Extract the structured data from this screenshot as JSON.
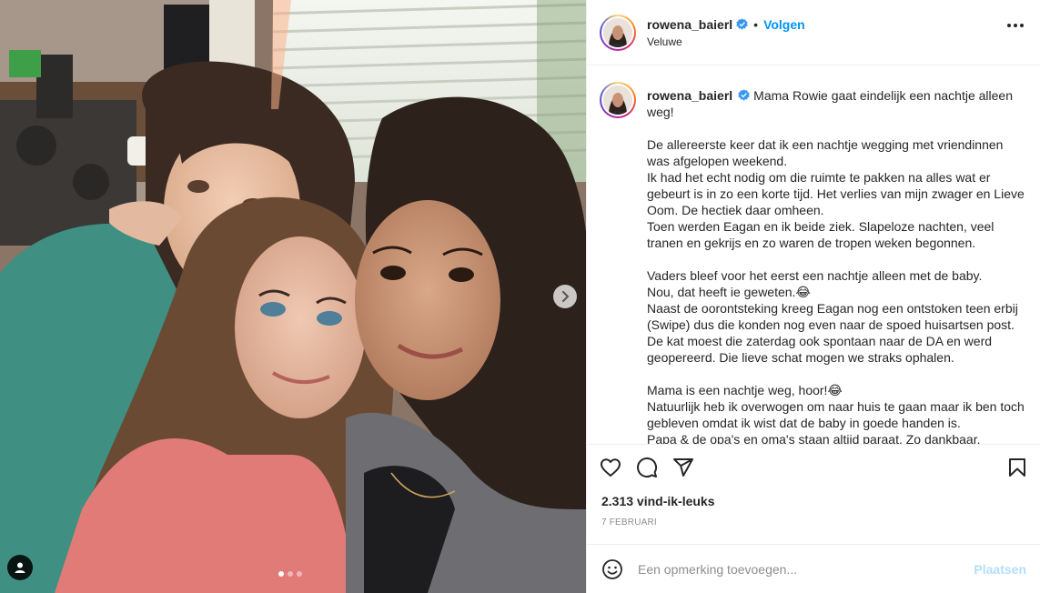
{
  "post": {
    "dots_count": 3,
    "active_dot": 0
  },
  "header": {
    "username": "rowena_baierl",
    "separator": "•",
    "follow_label": "Volgen",
    "location": "Veluwe",
    "verified_icon": "verified-badge-icon"
  },
  "caption": {
    "username": "rowena_baierl",
    "first_line": "Mama Rowie gaat eindelijk een nachtje alleen weg!",
    "paragraphs": [
      "De allereerste keer dat ik een nachtje wegging met vriendinnen was afgelopen weekend.\nIk had het echt nodig om die ruimte te pakken na alles wat er gebeurt is in zo een korte tijd. Het verlies van mijn zwager en Lieve Oom. De hectiek daar omheen.\nToen werden Eagan en ik beide ziek. Slapeloze nachten, veel tranen en gekrijs en zo waren de tropen weken begonnen.",
      "Vaders bleef voor het eerst een nachtje alleen met de baby.\nNou, dat heeft ie geweten.😂\nNaast de oorontsteking kreeg Eagan nog een ontstoken teen erbij (Swipe) dus die konden nog even naar de spoed huisartsen post. De kat moest die zaterdag ook spontaan naar de DA en werd geopereerd. Die lieve schat mogen we straks ophalen.",
      "Mama is een nachtje weg, hoor!😂\nNatuurlijk heb ik overwogen om naar huis te gaan maar ik ben toch gebleven omdat ik wist dat de baby in goede handen is.\nPapa & de opa's en oma's staan altijd paraat. Zo dankbaar."
    ]
  },
  "actions": {
    "like_icon": "heart-icon",
    "comment_icon": "comment-icon",
    "share_icon": "share-icon",
    "save_icon": "bookmark-icon",
    "likes_text": "2.313 vind-ik-leuks",
    "date_text": "7 FEBRUARI"
  },
  "comment": {
    "placeholder": "Een opmerking toevoegen...",
    "post_label": "Plaatsen",
    "emoji_icon": "smiley-icon"
  },
  "colors": {
    "accent": "#0095f6",
    "post_disabled": "#b2dffc",
    "muted": "#8e8e8e",
    "text": "#262626",
    "border": "#efefef"
  }
}
